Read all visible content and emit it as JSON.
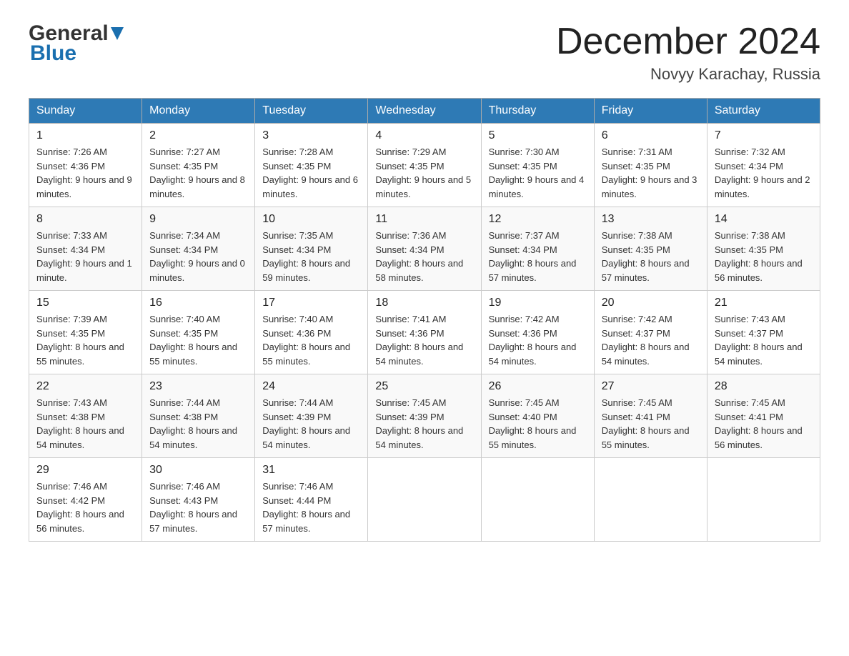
{
  "header": {
    "logo_general": "General",
    "logo_blue": "Blue",
    "month_year": "December 2024",
    "location": "Novyy Karachay, Russia"
  },
  "weekdays": [
    "Sunday",
    "Monday",
    "Tuesday",
    "Wednesday",
    "Thursday",
    "Friday",
    "Saturday"
  ],
  "weeks": [
    [
      {
        "day": "1",
        "sunrise": "7:26 AM",
        "sunset": "4:36 PM",
        "daylight": "9 hours and 9 minutes."
      },
      {
        "day": "2",
        "sunrise": "7:27 AM",
        "sunset": "4:35 PM",
        "daylight": "9 hours and 8 minutes."
      },
      {
        "day": "3",
        "sunrise": "7:28 AM",
        "sunset": "4:35 PM",
        "daylight": "9 hours and 6 minutes."
      },
      {
        "day": "4",
        "sunrise": "7:29 AM",
        "sunset": "4:35 PM",
        "daylight": "9 hours and 5 minutes."
      },
      {
        "day": "5",
        "sunrise": "7:30 AM",
        "sunset": "4:35 PM",
        "daylight": "9 hours and 4 minutes."
      },
      {
        "day": "6",
        "sunrise": "7:31 AM",
        "sunset": "4:35 PM",
        "daylight": "9 hours and 3 minutes."
      },
      {
        "day": "7",
        "sunrise": "7:32 AM",
        "sunset": "4:34 PM",
        "daylight": "9 hours and 2 minutes."
      }
    ],
    [
      {
        "day": "8",
        "sunrise": "7:33 AM",
        "sunset": "4:34 PM",
        "daylight": "9 hours and 1 minute."
      },
      {
        "day": "9",
        "sunrise": "7:34 AM",
        "sunset": "4:34 PM",
        "daylight": "9 hours and 0 minutes."
      },
      {
        "day": "10",
        "sunrise": "7:35 AM",
        "sunset": "4:34 PM",
        "daylight": "8 hours and 59 minutes."
      },
      {
        "day": "11",
        "sunrise": "7:36 AM",
        "sunset": "4:34 PM",
        "daylight": "8 hours and 58 minutes."
      },
      {
        "day": "12",
        "sunrise": "7:37 AM",
        "sunset": "4:34 PM",
        "daylight": "8 hours and 57 minutes."
      },
      {
        "day": "13",
        "sunrise": "7:38 AM",
        "sunset": "4:35 PM",
        "daylight": "8 hours and 57 minutes."
      },
      {
        "day": "14",
        "sunrise": "7:38 AM",
        "sunset": "4:35 PM",
        "daylight": "8 hours and 56 minutes."
      }
    ],
    [
      {
        "day": "15",
        "sunrise": "7:39 AM",
        "sunset": "4:35 PM",
        "daylight": "8 hours and 55 minutes."
      },
      {
        "day": "16",
        "sunrise": "7:40 AM",
        "sunset": "4:35 PM",
        "daylight": "8 hours and 55 minutes."
      },
      {
        "day": "17",
        "sunrise": "7:40 AM",
        "sunset": "4:36 PM",
        "daylight": "8 hours and 55 minutes."
      },
      {
        "day": "18",
        "sunrise": "7:41 AM",
        "sunset": "4:36 PM",
        "daylight": "8 hours and 54 minutes."
      },
      {
        "day": "19",
        "sunrise": "7:42 AM",
        "sunset": "4:36 PM",
        "daylight": "8 hours and 54 minutes."
      },
      {
        "day": "20",
        "sunrise": "7:42 AM",
        "sunset": "4:37 PM",
        "daylight": "8 hours and 54 minutes."
      },
      {
        "day": "21",
        "sunrise": "7:43 AM",
        "sunset": "4:37 PM",
        "daylight": "8 hours and 54 minutes."
      }
    ],
    [
      {
        "day": "22",
        "sunrise": "7:43 AM",
        "sunset": "4:38 PM",
        "daylight": "8 hours and 54 minutes."
      },
      {
        "day": "23",
        "sunrise": "7:44 AM",
        "sunset": "4:38 PM",
        "daylight": "8 hours and 54 minutes."
      },
      {
        "day": "24",
        "sunrise": "7:44 AM",
        "sunset": "4:39 PM",
        "daylight": "8 hours and 54 minutes."
      },
      {
        "day": "25",
        "sunrise": "7:45 AM",
        "sunset": "4:39 PM",
        "daylight": "8 hours and 54 minutes."
      },
      {
        "day": "26",
        "sunrise": "7:45 AM",
        "sunset": "4:40 PM",
        "daylight": "8 hours and 55 minutes."
      },
      {
        "day": "27",
        "sunrise": "7:45 AM",
        "sunset": "4:41 PM",
        "daylight": "8 hours and 55 minutes."
      },
      {
        "day": "28",
        "sunrise": "7:45 AM",
        "sunset": "4:41 PM",
        "daylight": "8 hours and 56 minutes."
      }
    ],
    [
      {
        "day": "29",
        "sunrise": "7:46 AM",
        "sunset": "4:42 PM",
        "daylight": "8 hours and 56 minutes."
      },
      {
        "day": "30",
        "sunrise": "7:46 AM",
        "sunset": "4:43 PM",
        "daylight": "8 hours and 57 minutes."
      },
      {
        "day": "31",
        "sunrise": "7:46 AM",
        "sunset": "4:44 PM",
        "daylight": "8 hours and 57 minutes."
      },
      null,
      null,
      null,
      null
    ]
  ],
  "labels": {
    "sunrise": "Sunrise:",
    "sunset": "Sunset:",
    "daylight": "Daylight:"
  }
}
